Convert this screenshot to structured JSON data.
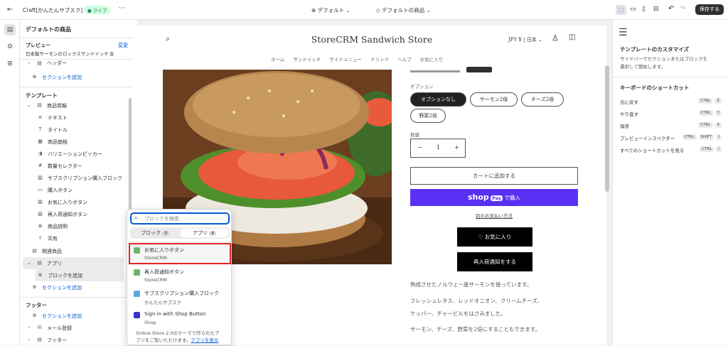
{
  "topbar": {
    "app_name": "Craft[かんたんサブスク]",
    "live_badge": "● ライブ",
    "more": "···",
    "theme_label": "デフォルト",
    "template_label": "デフォルトの商品",
    "save_label": "保存する"
  },
  "sidebar": {
    "title": "デフォルトの商品",
    "preview_label": "プレビュー",
    "preview_change": "変更",
    "preview_product": "日本製サーモンのロックスサンドイッチ",
    "header_section": "ヘッダー",
    "add_section_top": "セクションを追加",
    "template_heading": "テンプレート",
    "product_info": "商品情報",
    "blocks": [
      "テキスト",
      "タイトル",
      "商品価格",
      "バリエーションピッカー",
      "数量セレクター",
      "サブスクリプション購入ブロック",
      "購入ボタン",
      "お気に入りボタン",
      "再入荷通知ボタン",
      "商品説明",
      "共有"
    ],
    "related": "関連商品",
    "app": "アプリ",
    "add_block": "ブロックを追加",
    "add_section_mid": "セクションを追加",
    "footer_heading": "フッター",
    "add_section_footer": "セクションを追加",
    "newsletter": "メール登録",
    "footer": "フッター"
  },
  "popover": {
    "search_placeholder": "ブロックを検索",
    "tab_blocks": "ブロック",
    "tab_blocks_count": "0",
    "tab_apps": "アプリ",
    "tab_apps_count": "4",
    "items": [
      {
        "title": "お気に入りボタン",
        "sub": "StoreCRM"
      },
      {
        "title": "再入荷通知ボタン",
        "sub": "StoreCRM"
      },
      {
        "title": "サブスクリプション購入ブロック",
        "sub": "かんたんサブスク"
      },
      {
        "title": "Sign in with Shop Button",
        "sub": "Shop"
      }
    ],
    "footer_text_1": "Online Store 2.0のテーマで作られたア",
    "footer_text_2": "プリをご覧いただけます。",
    "footer_link": "アプリを表示"
  },
  "store": {
    "name": "StoreCRM Sandwich Store",
    "currency": "JPY ¥ | 日本 ⌄",
    "nav": [
      "ホーム",
      "サンドイッチ",
      "サイドメニュー",
      "ドリンク",
      "ヘルプ",
      "お気に入り"
    ],
    "option_label": "オプション",
    "options": [
      "オプションなし",
      "サーモン2倍",
      "チーズ2倍",
      "野菜2倍"
    ],
    "qty_label": "数量",
    "qty_value": "1",
    "qty_minus": "−",
    "qty_plus": "+",
    "add_to_cart": "カートに追加する",
    "shop_pay_word": "shop",
    "shop_pay_pill": "Pay",
    "shop_pay_suffix": "で購入",
    "other_payment": "別のお支払い方法",
    "favorite": "♡ お気に入り",
    "restock": "再入荷通知をする",
    "desc": [
      "熟成させたノルウェー産サーモンを使っています。",
      "フレッシュレタス、レッドオニオン、クリームチーズ、",
      "ケッパー、チャービルをはさみました。",
      "サーモン、チーズ、野菜を2倍にすることもできます。"
    ]
  },
  "right": {
    "title": "テンプレートのカスタマイズ",
    "desc1": "サイドバーでセクションまたはブロックを",
    "desc2": "選択して開始します。",
    "kb_title": "キーボードのショートカット",
    "shortcuts": [
      {
        "label": "元に戻す",
        "keys": [
          "CTRL",
          "Z"
        ]
      },
      {
        "label": "やり直す",
        "keys": [
          "CTRL",
          "Y"
        ]
      },
      {
        "label": "保存",
        "keys": [
          "CTRL",
          "S"
        ]
      },
      {
        "label": "プレビューインスペクター",
        "keys": [
          "CTRL",
          "SHIFT",
          "I"
        ]
      },
      {
        "label": "すべてのショートカットを見る",
        "keys": [
          "CTRL",
          "/"
        ]
      }
    ]
  },
  "colors": {
    "accent": "#005bd3",
    "live": "#29845a",
    "shop_pay": "#5a31f4",
    "highlight": "#e02424",
    "black": "#000000"
  }
}
